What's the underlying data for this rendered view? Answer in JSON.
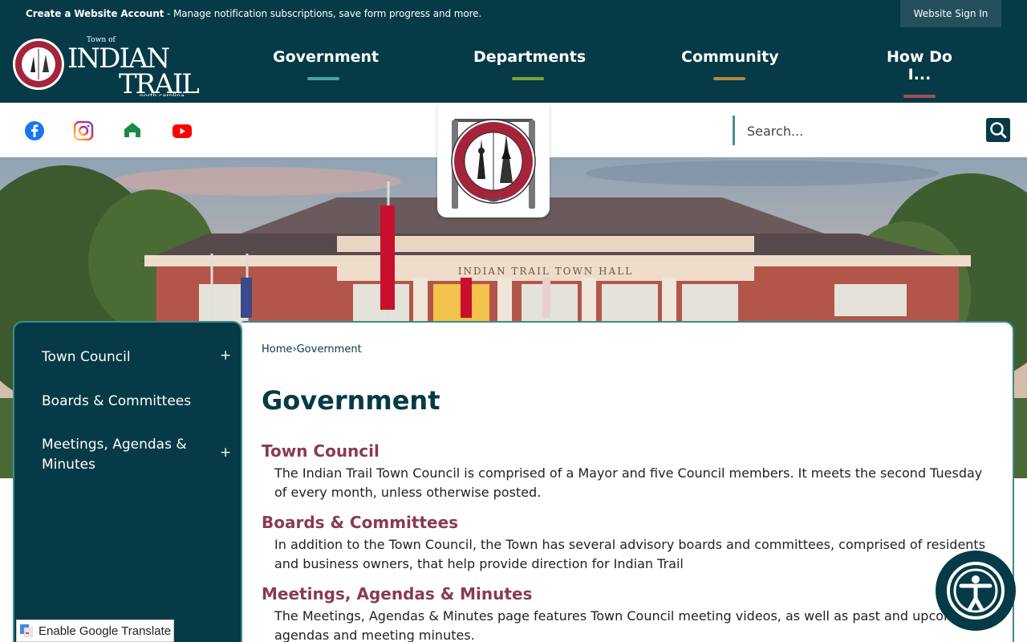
{
  "topbar": {
    "account_link": "Create a Website Account",
    "account_desc": " - Manage notification subscriptions, save form progress and more.",
    "signin_label": "Website Sign In"
  },
  "logo": {
    "town_of": "Town of",
    "name_line1": "INDIAN",
    "name_line2": "TRAIL",
    "state": "north carolina"
  },
  "nav": [
    {
      "label": "Government",
      "color": "#4aa3a6"
    },
    {
      "label": "Departments",
      "color": "#7aa33c"
    },
    {
      "label": "Community",
      "color": "#b08a3a"
    },
    {
      "label": "How Do I...",
      "color": "#a84a5e"
    }
  ],
  "social": [
    "facebook-icon",
    "instagram-icon",
    "nextdoor-icon",
    "youtube-icon"
  ],
  "search": {
    "placeholder": "Search..."
  },
  "hero": {
    "building_sign": "INDIAN TRAIL TOWN HALL"
  },
  "sidenav": {
    "items": [
      {
        "label": "Town Council",
        "expandable": "+"
      },
      {
        "label": "Boards & Committees"
      },
      {
        "label": "Meetings, Agendas & Minutes",
        "expandable": "+"
      }
    ]
  },
  "breadcrumb": {
    "home": "Home",
    "sep": "›",
    "current": "Government"
  },
  "main": {
    "title": "Government",
    "sections": [
      {
        "title": "Town Council",
        "desc": "The Indian Trail Town Council is comprised of a Mayor and five Council members. It meets the second Tuesday of every month, unless otherwise posted."
      },
      {
        "title": "Boards & Committees",
        "desc": "In addition to the Town Council, the Town has several advisory boards and committees, comprised of residents and business owners, that help provide direction for Indian Trail"
      },
      {
        "title": "Meetings, Agendas & Minutes",
        "desc": "The Meetings, Agendas & Minutes page features Town Council meeting videos, as well as past and upcoming agendas and meeting minutes."
      }
    ]
  },
  "translate": {
    "label": "Enable Google Translate"
  }
}
